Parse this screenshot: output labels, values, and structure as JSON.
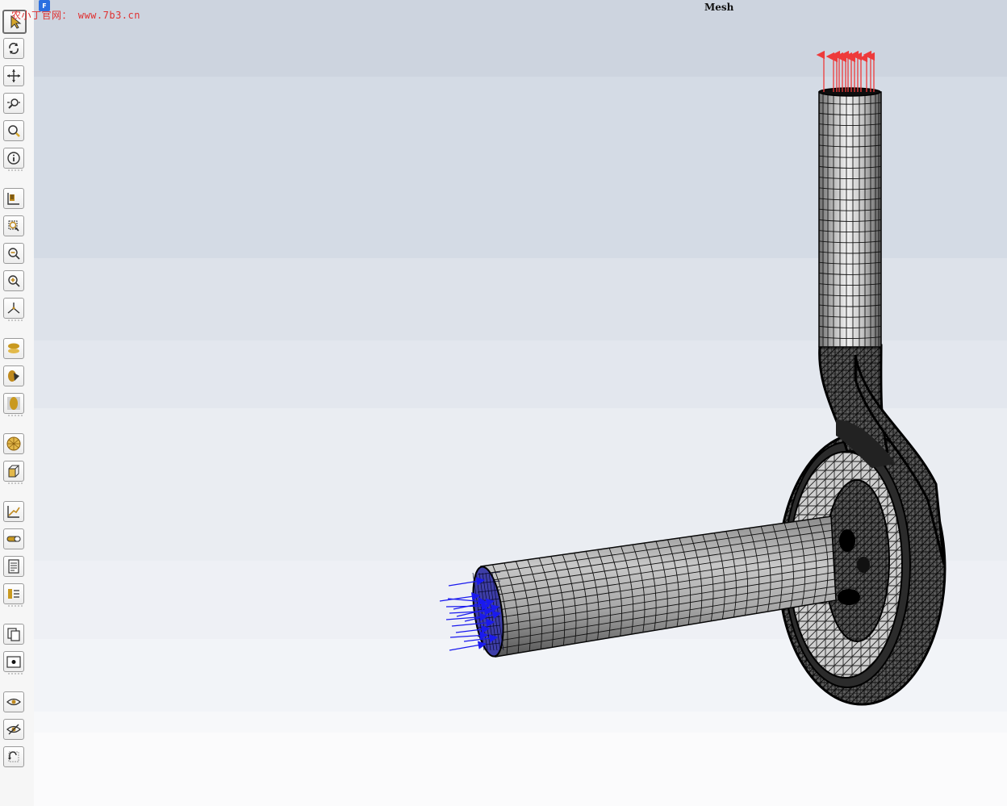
{
  "watermark": {
    "text": "农小丁官网： www.7b3.cn"
  },
  "badge": {
    "text": "F"
  },
  "viewport": {
    "title": "Mesh"
  },
  "toolbar": {
    "groups": [
      [
        "select-icon",
        "rotate-icon",
        "pan-icon",
        "zoom-icon",
        "zoom-window-icon",
        "info-icon"
      ],
      [
        "view-orient-icon",
        "zoom-box-icon",
        "zoom-out-icon",
        "zoom-in-icon",
        "axis-triad-icon"
      ],
      [
        "hide-surfaces-icon",
        "shaded-icon",
        "transparent-icon"
      ],
      [
        "mesh-sphere-icon",
        "box-icon"
      ],
      [
        "plot-axis-icon",
        "scale-bar-icon",
        "report-icon",
        "legend-icon"
      ],
      [
        "copy-icon",
        "snapshot-icon"
      ],
      [
        "show-icon",
        "hide-icon",
        "reset-icon"
      ]
    ]
  },
  "colors": {
    "inlet_arrows": "#1a1aee",
    "outlet_arrows": "#ee3b3b",
    "mesh_fill": "#aaaaaa",
    "mesh_lines": "#111111"
  }
}
